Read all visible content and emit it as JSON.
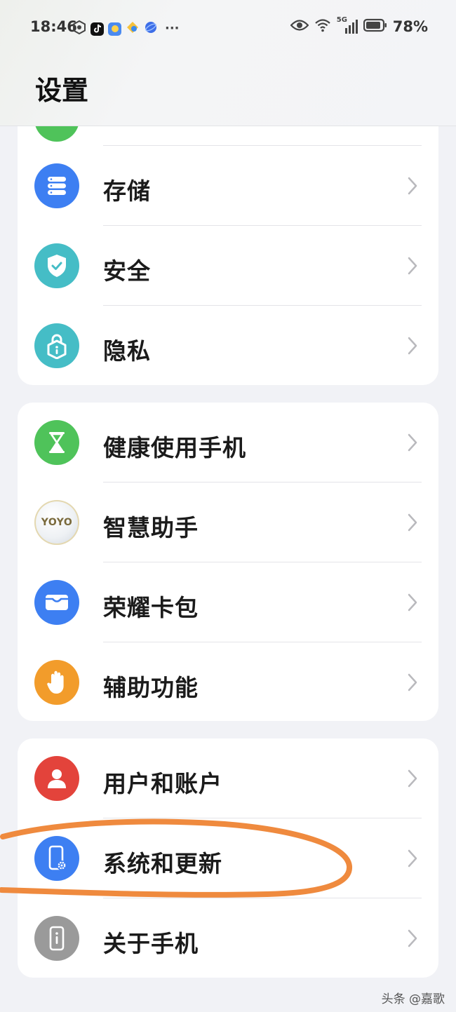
{
  "status_bar": {
    "time": "18:46",
    "network": "5G",
    "battery": "78%"
  },
  "header": {
    "title": "设置"
  },
  "groups": [
    {
      "items": [
        {
          "label": "存储",
          "icon": "storage-icon",
          "color": "#3d7ff2"
        },
        {
          "label": "安全",
          "icon": "shield-icon",
          "color": "#45bdc6"
        },
        {
          "label": "隐私",
          "icon": "privacy-lock-icon",
          "color": "#45bdc6"
        }
      ]
    },
    {
      "items": [
        {
          "label": "健康使用手机",
          "icon": "hourglass-icon",
          "color": "#4fc35a"
        },
        {
          "label": "智慧助手",
          "icon": "yoyo-icon",
          "icon_text": "YOYO",
          "color": "#e9edf2"
        },
        {
          "label": "荣耀卡包",
          "icon": "wallet-icon",
          "color": "#3d7ff2"
        },
        {
          "label": "辅助功能",
          "icon": "hand-icon",
          "color": "#f29c2b"
        }
      ]
    },
    {
      "items": [
        {
          "label": "用户和账户",
          "icon": "user-icon",
          "color": "#e3433b"
        },
        {
          "label": "系统和更新",
          "icon": "system-update-icon",
          "color": "#3d7ff2"
        },
        {
          "label": "关于手机",
          "icon": "phone-info-icon",
          "color": "#9a9a9a"
        }
      ]
    }
  ],
  "annotation_color": "#ef8a3e",
  "watermark": "头条 @嘉歌"
}
